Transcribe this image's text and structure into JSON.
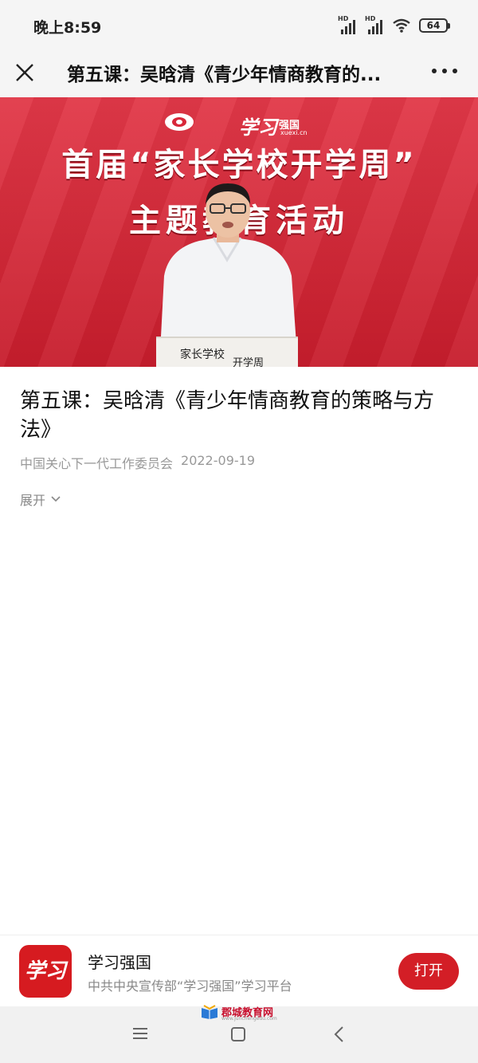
{
  "status": {
    "time": "晚上8:59",
    "signal1_label": "HD",
    "signal2_label": "HD",
    "battery": "64"
  },
  "nav": {
    "title": "第五课：吴晗清《青少年情商教育的..."
  },
  "video": {
    "brand": "学习",
    "brand_sub": "强国",
    "brand_url": "xuexi.cn",
    "banner_line1": "首届“家长学校开学周”",
    "banner_line2": "主题教育活动",
    "podium_text": "家长学校",
    "podium_text2": "开学周"
  },
  "article": {
    "title": "第五课：吴晗清《青少年情商教育的策略与方法》",
    "source": "中国关心下一代工作委员会",
    "date": "2022-09-19",
    "expand_label": "展开"
  },
  "app_card": {
    "icon_text": "学习",
    "name": "学习强国",
    "description": "中共中央宣传部“学习强国”学习平台",
    "open_label": "打开"
  },
  "watermark": {
    "text": "郡城教育网",
    "sub": "www.junchengedu.com"
  },
  "colors": {
    "accent_red": "#d31e26",
    "banner_red": "#c61d2c"
  },
  "icons": [
    "close-icon",
    "more-icon",
    "chevron-down-icon",
    "menu-icon",
    "home-icon",
    "back-icon",
    "wifi-icon",
    "battery-icon",
    "signal-icon"
  ]
}
